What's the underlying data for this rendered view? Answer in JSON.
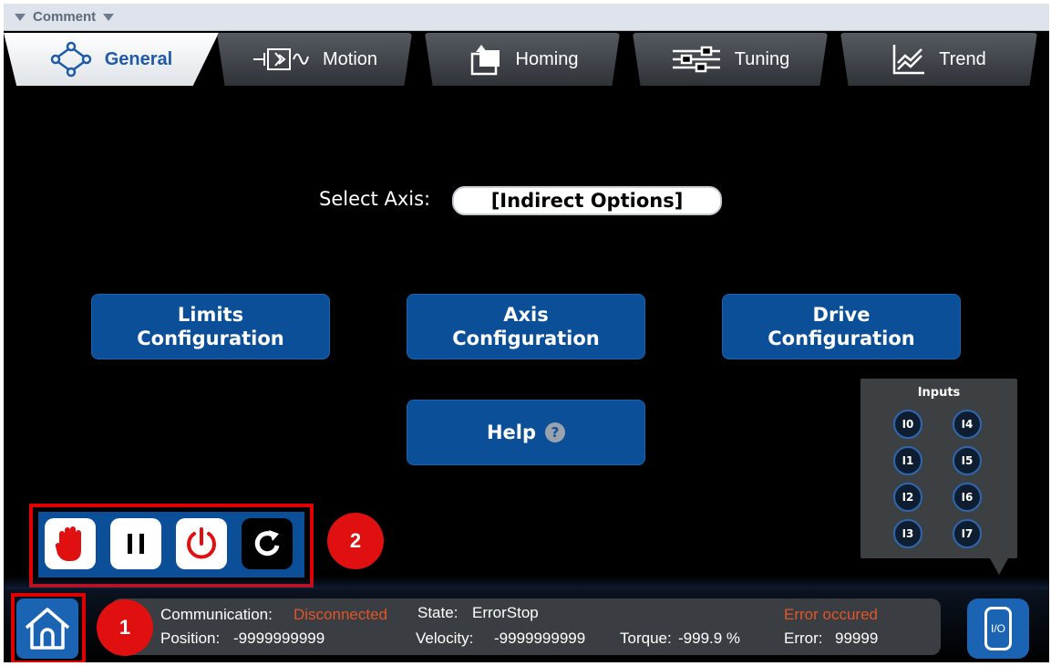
{
  "comment_bar": {
    "label": "Comment"
  },
  "tabs": [
    {
      "label": "General",
      "icon": "diamond-nodes-icon",
      "active": true
    },
    {
      "label": "Motion",
      "icon": "motion-icon",
      "active": false
    },
    {
      "label": "Homing",
      "icon": "homing-icon",
      "active": false
    },
    {
      "label": "Tuning",
      "icon": "sliders-icon",
      "active": false
    },
    {
      "label": "Trend",
      "icon": "trend-chart-icon",
      "active": false
    }
  ],
  "select_axis": {
    "label": "Select Axis:",
    "value": "[Indirect Options]"
  },
  "buttons": {
    "limits": {
      "line1": "Limits",
      "line2": "Configuration"
    },
    "axis": {
      "line1": "Axis",
      "line2": "Configuration"
    },
    "drive": {
      "line1": "Drive",
      "line2": "Configuration"
    },
    "help": {
      "label": "Help",
      "icon_glyph": "?"
    }
  },
  "inputs_panel": {
    "title": "Inputs",
    "inputs": [
      "I0",
      "I1",
      "I2",
      "I3",
      "I4",
      "I5",
      "I6",
      "I7"
    ]
  },
  "control_buttons": [
    {
      "name": "stop",
      "icon": "hand-stop-icon"
    },
    {
      "name": "pause",
      "icon": "pause-icon"
    },
    {
      "name": "power",
      "icon": "power-icon"
    },
    {
      "name": "reset",
      "icon": "refresh-icon"
    }
  ],
  "annotations": {
    "badge1": "1",
    "badge2": "2"
  },
  "status": {
    "communication_label": "Communication:",
    "communication_value": "Disconnected",
    "position_label": "Position:",
    "position_value": "-9999999999",
    "state_label": "State:",
    "state_value": "ErrorStop",
    "velocity_label": "Velocity:",
    "velocity_value": "-9999999999",
    "torque_label": "Torque:",
    "torque_value": "-999.9 %",
    "error_message": "Error occured",
    "error_label": "Error:",
    "error_value": "99999"
  },
  "io_button": {
    "label": "I/O"
  },
  "colors": {
    "accent_blue": "#0b4f99",
    "error_red": "#e2552a",
    "highlight_red": "#e00000"
  }
}
